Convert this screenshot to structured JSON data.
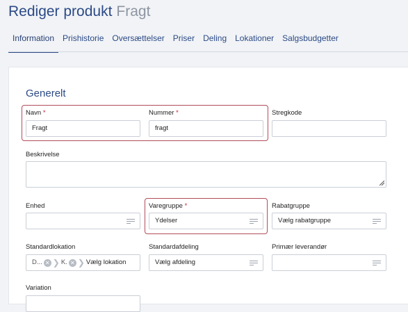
{
  "page": {
    "title": "Rediger produkt",
    "subtitle": "Fragt"
  },
  "tabs": [
    {
      "label": "Information",
      "active": true
    },
    {
      "label": "Prishistorie"
    },
    {
      "label": "Oversættelser"
    },
    {
      "label": "Priser"
    },
    {
      "label": "Deling"
    },
    {
      "label": "Lokationer"
    },
    {
      "label": "Salgsbudgetter"
    }
  ],
  "section": {
    "title": "Generelt"
  },
  "required_marker": "*",
  "fields": {
    "navn": {
      "label": "Navn",
      "value": "Fragt"
    },
    "nummer": {
      "label": "Nummer",
      "value": "fragt"
    },
    "stregkode": {
      "label": "Stregkode",
      "value": ""
    },
    "beskrivelse": {
      "label": "Beskrivelse",
      "value": ""
    },
    "enhed": {
      "label": "Enhed",
      "value": ""
    },
    "varegruppe": {
      "label": "Varegruppe",
      "value": "Ydelser"
    },
    "rabatgruppe": {
      "label": "Rabatgruppe",
      "placeholder": "Vælg rabatgruppe"
    },
    "standardlokation": {
      "label": "Standardlokation",
      "chip1": "D...",
      "chip2": "K.",
      "placeholder": "Vælg lokation"
    },
    "standardafdeling": {
      "label": "Standardafdeling",
      "placeholder": "Vælg afdeling"
    },
    "primaer_leverandor": {
      "label": "Primær leverandør",
      "value": ""
    },
    "variation": {
      "label": "Variation"
    }
  },
  "colors": {
    "accent": "#2c4a86",
    "highlight_border": "#b24c5a",
    "required": "#cc2233"
  }
}
